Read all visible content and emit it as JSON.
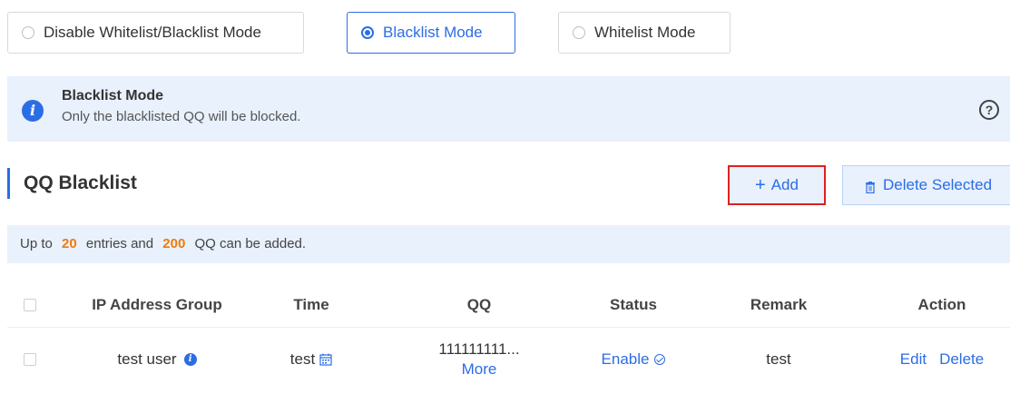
{
  "modes": [
    {
      "label": "Disable Whitelist/Blacklist Mode",
      "selected": false
    },
    {
      "label": "Blacklist Mode",
      "selected": true
    },
    {
      "label": "Whitelist Mode",
      "selected": false
    }
  ],
  "info": {
    "title": "Blacklist Mode",
    "description": "Only the blacklisted QQ will be blocked.",
    "help_symbol": "?"
  },
  "section": {
    "title": "QQ Blacklist",
    "add_label": "Add",
    "add_symbol": "+",
    "delete_selected_label": "Delete Selected"
  },
  "limit": {
    "prefix": "Up to",
    "entries_count": "20",
    "middle": "entries and",
    "qq_count": "200",
    "suffix": "QQ can be added."
  },
  "table": {
    "headers": [
      "IP Address Group",
      "Time",
      "QQ",
      "Status",
      "Remark",
      "Action"
    ],
    "rows": [
      {
        "ip_group": "test user",
        "time": "test",
        "qq": "111111111...",
        "qq_more": "More",
        "status": "Enable",
        "remark": "test",
        "edit": "Edit",
        "delete": "Delete"
      }
    ]
  },
  "colors": {
    "accent": "#2b6de5",
    "highlight_border": "#e02020",
    "count_orange": "#f07a0a",
    "info_bg": "#e8f1fc"
  },
  "icons": [
    "info-icon",
    "help-icon",
    "trash-icon",
    "calendar-icon",
    "check-circle-icon"
  ]
}
